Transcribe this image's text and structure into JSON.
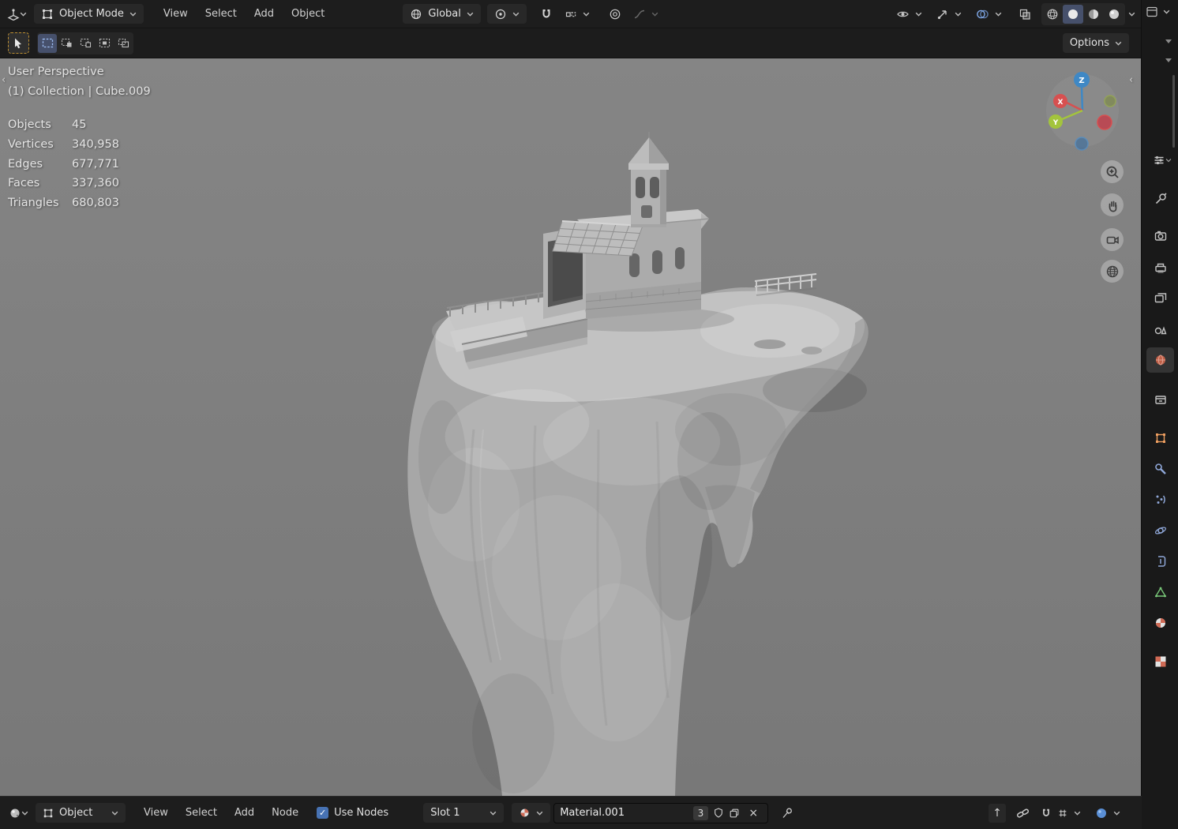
{
  "colors": {
    "accent": "#4772b3",
    "header_bg": "#1d1d1d",
    "viewport_bg": "#7e7e7e",
    "axis_x": "#d75050",
    "axis_y": "#a3c43d",
    "axis_z": "#3f88c5",
    "object_accent": "#ec9d5f"
  },
  "topbar": {
    "mode_label": "Object Mode",
    "menus": [
      {
        "label": "View"
      },
      {
        "label": "Select"
      },
      {
        "label": "Add"
      },
      {
        "label": "Object"
      }
    ],
    "orientation_label": "Global"
  },
  "tool_settings": {
    "options_label": "Options"
  },
  "viewport": {
    "perspective_label": "User Perspective",
    "context_label": "(1) Collection | Cube.009",
    "stats": {
      "rows": [
        {
          "label": "Objects",
          "value": "45"
        },
        {
          "label": "Vertices",
          "value": "340,958"
        },
        {
          "label": "Edges",
          "value": "677,771"
        },
        {
          "label": "Faces",
          "value": "337,360"
        },
        {
          "label": "Triangles",
          "value": "680,803"
        }
      ]
    },
    "gizmo": {
      "x": "X",
      "y": "Y",
      "z": "Z"
    }
  },
  "bottombar": {
    "shader_type_label": "Object",
    "menus": [
      {
        "label": "View"
      },
      {
        "label": "Select"
      },
      {
        "label": "Add"
      },
      {
        "label": "Node"
      }
    ],
    "use_nodes_label": "Use Nodes",
    "slot_label": "Slot 1",
    "material_name": "Material.001",
    "users_count": "3"
  },
  "glyphs": {
    "check": "✓",
    "close": "×",
    "up_arrow": "↑",
    "collapse": "‹"
  }
}
